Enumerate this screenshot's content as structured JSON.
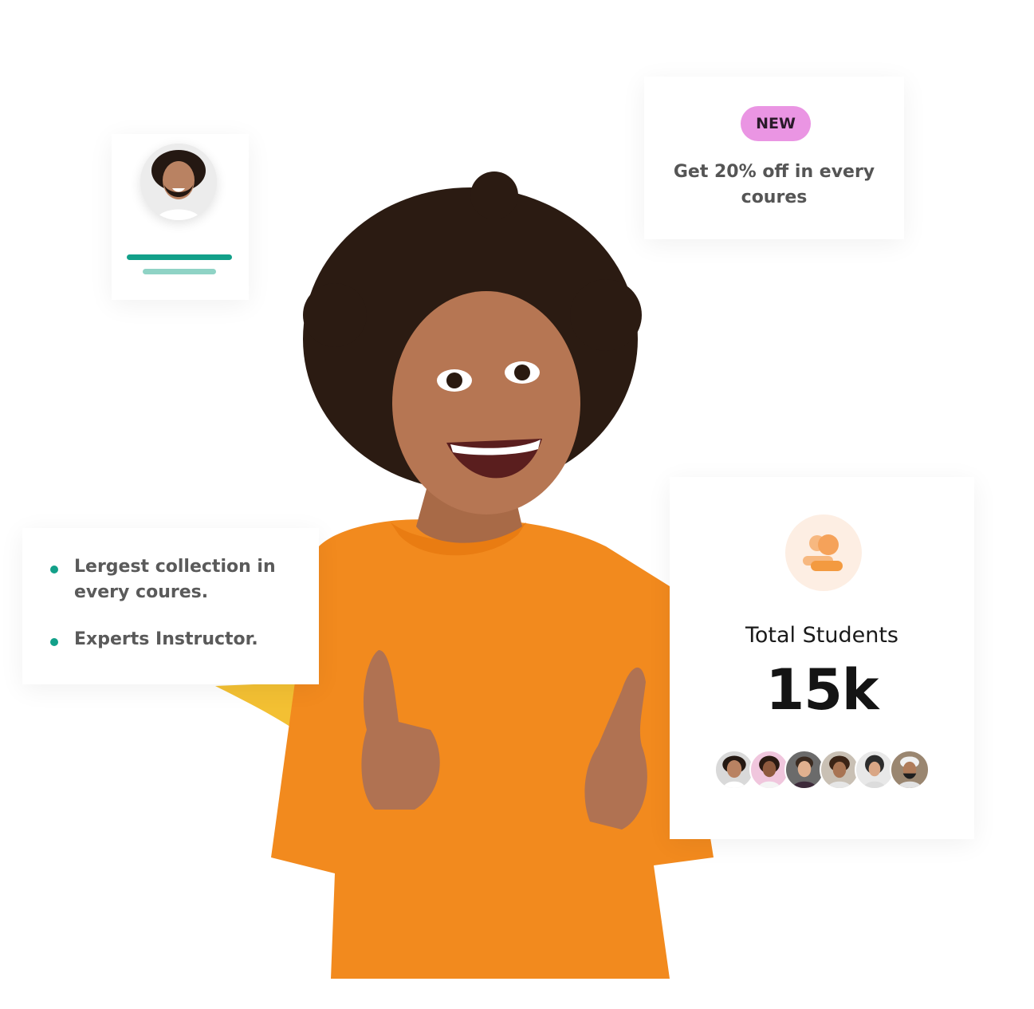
{
  "promo": {
    "badge": "NEW",
    "text": "Get 20% off in every coures"
  },
  "features": [
    "Lergest collection in every coures.",
    "Experts Instructor."
  ],
  "stats": {
    "label": "Total Students",
    "value": "15k"
  },
  "colors": {
    "accent_green": "#12a089",
    "badge_pink": "#ea95e3",
    "sweater_orange": "#f28a1e",
    "icon_orange": "#f5a25a"
  },
  "icons": {
    "students": "users-icon"
  }
}
